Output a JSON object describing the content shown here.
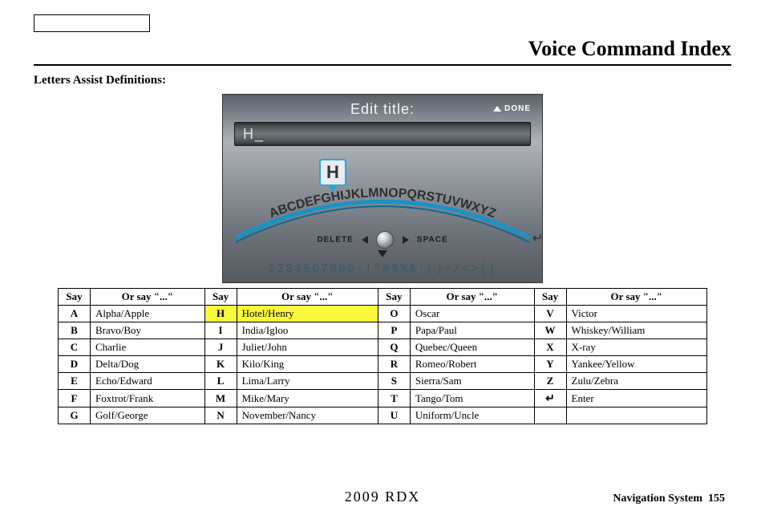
{
  "header": {
    "title": "Voice Command Index",
    "subtitle": "Letters Assist Definitions:"
  },
  "device": {
    "screen_title": "Edit title:",
    "done_label": "DONE",
    "input_value": "H_",
    "selected_key": "H",
    "alpha_row": "ABCDEFGHIJKLMNOPQRSTUVWXYZ",
    "delete_label": "DELETE",
    "space_label": "SPACE",
    "symbol_row": "1234567890-!\"#$%&'()~/<>{}"
  },
  "table": {
    "headers": [
      "Say",
      "Or say \"...\"",
      "Say",
      "Or say \"...\"",
      "Say",
      "Or say \"...\"",
      "Say",
      "Or say \"...\""
    ],
    "rows": [
      {
        "c": [
          {
            "say": "A",
            "alt": "Alpha/Apple"
          },
          {
            "say": "H",
            "alt": "Hotel/Henry",
            "hl": true
          },
          {
            "say": "O",
            "alt": "Oscar"
          },
          {
            "say": "V",
            "alt": "Victor"
          }
        ]
      },
      {
        "c": [
          {
            "say": "B",
            "alt": "Bravo/Boy"
          },
          {
            "say": "I",
            "alt": "India/Igloo"
          },
          {
            "say": "P",
            "alt": "Papa/Paul"
          },
          {
            "say": "W",
            "alt": "Whiskey/William"
          }
        ]
      },
      {
        "c": [
          {
            "say": "C",
            "alt": "Charlie"
          },
          {
            "say": "J",
            "alt": "Juliet/John"
          },
          {
            "say": "Q",
            "alt": "Quebec/Queen"
          },
          {
            "say": "X",
            "alt": "X-ray"
          }
        ]
      },
      {
        "c": [
          {
            "say": "D",
            "alt": "Delta/Dog"
          },
          {
            "say": "K",
            "alt": "Kilo/King"
          },
          {
            "say": "R",
            "alt": "Romeo/Robert"
          },
          {
            "say": "Y",
            "alt": "Yankee/Yellow"
          }
        ]
      },
      {
        "c": [
          {
            "say": "E",
            "alt": "Echo/Edward"
          },
          {
            "say": "L",
            "alt": "Lima/Larry"
          },
          {
            "say": "S",
            "alt": "Sierra/Sam"
          },
          {
            "say": "Z",
            "alt": "Zulu/Zebra"
          }
        ]
      },
      {
        "c": [
          {
            "say": "F",
            "alt": "Foxtrot/Frank"
          },
          {
            "say": "M",
            "alt": "Mike/Mary"
          },
          {
            "say": "T",
            "alt": "Tango/Tom"
          },
          {
            "say": "↵",
            "alt": "Enter",
            "sym": true
          }
        ]
      },
      {
        "c": [
          {
            "say": "G",
            "alt": "Golf/George"
          },
          {
            "say": "N",
            "alt": "November/Nancy"
          },
          {
            "say": "U",
            "alt": "Uniform/Uncle"
          },
          {
            "say": "",
            "alt": ""
          }
        ]
      }
    ]
  },
  "footer": {
    "center": "2009  RDX",
    "right_label": "Navigation System",
    "page_num": "155"
  }
}
